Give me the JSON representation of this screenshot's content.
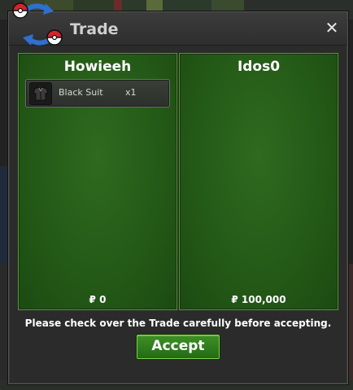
{
  "window": {
    "title": "Trade",
    "close_label": "✕",
    "logo_icon": "trade-swap-icon"
  },
  "left_panel": {
    "player_name": "Howieeh",
    "items": [
      {
        "name": "Black Suit",
        "quantity": "x1",
        "icon": "black-suit-icon"
      }
    ],
    "money": "₽ 0"
  },
  "right_panel": {
    "player_name": "Idos0",
    "items": [],
    "money": "₽ 100,000"
  },
  "footer": {
    "notice": "Please check over the Trade carefully before accepting.",
    "accept_label": "Accept"
  },
  "colors": {
    "panel_green": "#245a17",
    "panel_border": "#4f9a2f",
    "accept_green": "#2f7d1d",
    "window_bg": "#2b2b2b"
  }
}
